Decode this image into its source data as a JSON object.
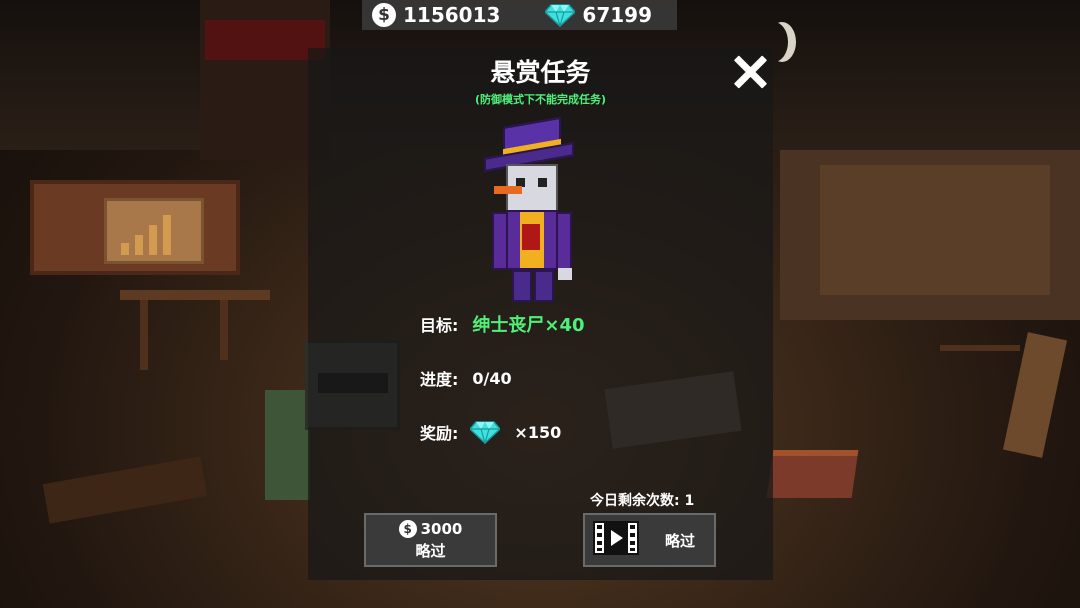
{
  "currency": {
    "coins": "1156013",
    "gems": "67199",
    "coin_icon_glyph": "$",
    "gem_color": "#3ee0e0"
  },
  "dialog": {
    "title": "悬赏任务",
    "subtitle": "(防御模式下不能完成任务)",
    "target_label": "目标:",
    "target_value": "绅士丧尸×40",
    "progress_label": "进度:",
    "progress_value": "0/40",
    "reward_label": "奖励:",
    "reward_value": "×150",
    "remaining_text": "今日剩余次数: 1",
    "accent_color": "#4ff07a"
  },
  "buttons": {
    "coin_skip_cost": "3000",
    "coin_skip_label": "略过",
    "video_skip_label": "略过",
    "coin_icon_glyph": "$"
  },
  "icons": {
    "close": "close-icon",
    "coin": "coin-icon",
    "gem": "gem-icon",
    "video": "film-icon"
  }
}
